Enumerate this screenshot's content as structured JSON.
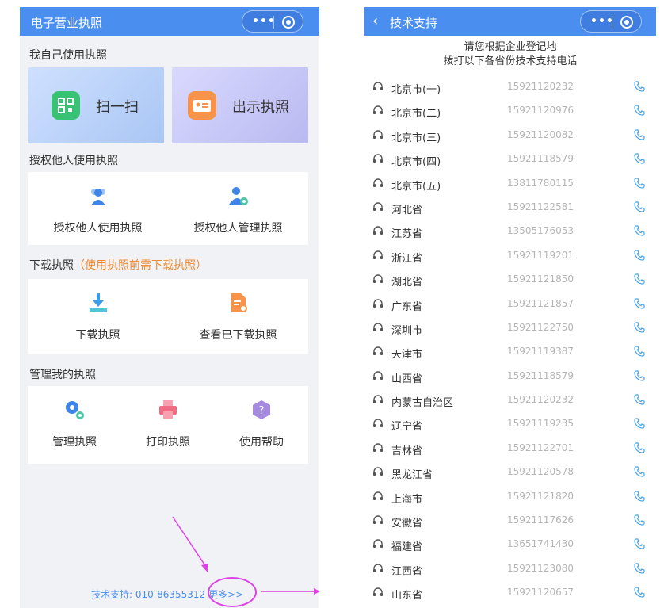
{
  "left": {
    "title": "电子营业执照",
    "section_self": "我自己使用执照",
    "scan_label": "扫一扫",
    "show_label": "出示执照",
    "section_auth": "授权他人使用执照",
    "auth_use_label": "授权他人使用执照",
    "auth_manage_label": "授权他人管理执照",
    "section_download": "下载执照",
    "section_download_hint": "（使用执照前需下载执照）",
    "download_label": "下载执照",
    "view_downloaded_label": "查看已下载执照",
    "section_manage": "管理我的执照",
    "manage_label": "管理执照",
    "print_label": "打印执照",
    "help_label": "使用帮助",
    "support_text": "技术支持: 010-86355312",
    "more_link": "更多>>"
  },
  "right": {
    "title": "技术支持",
    "header_line1": "请您根据企业登记地",
    "header_line2": "拨打以下各省份技术支持电话",
    "rows": [
      {
        "name": "北京市(一)",
        "phone": "15921120232"
      },
      {
        "name": "北京市(二)",
        "phone": "15921120976"
      },
      {
        "name": "北京市(三)",
        "phone": "15921120082"
      },
      {
        "name": "北京市(四)",
        "phone": "15921118579"
      },
      {
        "name": "北京市(五)",
        "phone": "13811780115"
      },
      {
        "name": "河北省",
        "phone": "15921122581"
      },
      {
        "name": "江苏省",
        "phone": "13505176053"
      },
      {
        "name": "浙江省",
        "phone": "15921119201"
      },
      {
        "name": "湖北省",
        "phone": "15921121850"
      },
      {
        "name": "广东省",
        "phone": "15921121857"
      },
      {
        "name": "深圳市",
        "phone": "15921122750"
      },
      {
        "name": "天津市",
        "phone": "15921119387"
      },
      {
        "name": "山西省",
        "phone": "15921118579"
      },
      {
        "name": "内蒙古自治区",
        "phone": "15921120232"
      },
      {
        "name": "辽宁省",
        "phone": "15921119235"
      },
      {
        "name": "吉林省",
        "phone": "15921122701"
      },
      {
        "name": "黑龙江省",
        "phone": "15921120578"
      },
      {
        "name": "上海市",
        "phone": "15921121820"
      },
      {
        "name": "安徽省",
        "phone": "15921117626"
      },
      {
        "name": "福建省",
        "phone": "13651741430"
      },
      {
        "name": "江西省",
        "phone": "15921123080"
      },
      {
        "name": "山东省",
        "phone": "15921120657"
      }
    ]
  },
  "colors": {
    "primary": "#4a8ef0",
    "annotation": "#e040e8",
    "hint": "#f08a30"
  }
}
